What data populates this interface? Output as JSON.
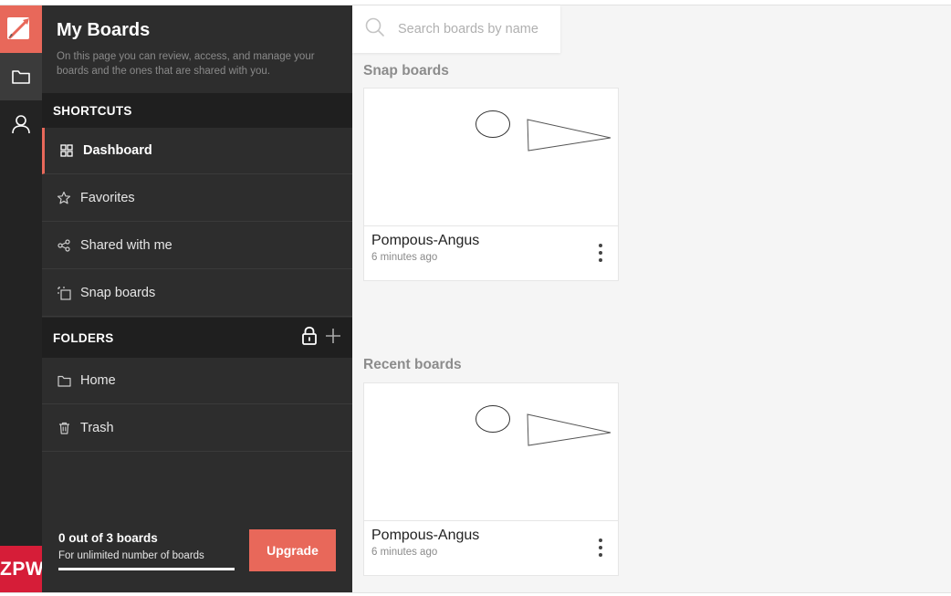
{
  "rail": {
    "logo_icon": "app-logo-icon",
    "items": [
      {
        "icon": "folder-icon",
        "active": true
      },
      {
        "icon": "user-icon",
        "active": false
      }
    ],
    "brand_badge": "ZPW"
  },
  "sidebar": {
    "title": "My Boards",
    "description": "On this page you can review, access, and manage your boards and the ones that are shared with you.",
    "shortcuts_label": "SHORTCUTS",
    "shortcuts": [
      {
        "label": "Dashboard",
        "icon": "grid-icon",
        "active": true
      },
      {
        "label": "Favorites",
        "icon": "star-icon",
        "active": false
      },
      {
        "label": "Shared with me",
        "icon": "share-icon",
        "active": false
      },
      {
        "label": "Snap boards",
        "icon": "snap-icon",
        "active": false
      }
    ],
    "folders_label": "FOLDERS",
    "folders": [
      {
        "label": "Home",
        "icon": "folder-icon"
      },
      {
        "label": "Trash",
        "icon": "trash-icon"
      }
    ],
    "footer": {
      "count": "0 out of 3 boards",
      "subtitle": "For unlimited number of boards",
      "upgrade_label": "Upgrade"
    }
  },
  "search": {
    "placeholder": "Search boards by name"
  },
  "sections": {
    "snap_title": "Snap boards",
    "recent_title": "Recent boards"
  },
  "snap_boards": [
    {
      "name": "Pompous-Angus",
      "time": "6 minutes ago"
    }
  ],
  "recent_boards": [
    {
      "name": "Pompous-Angus",
      "time": "6 minutes ago"
    }
  ],
  "colors": {
    "accent": "#e8685a",
    "rail_bg": "#232323",
    "sidebar_bg": "#2d2d2d",
    "brand_red": "#d61d38"
  }
}
